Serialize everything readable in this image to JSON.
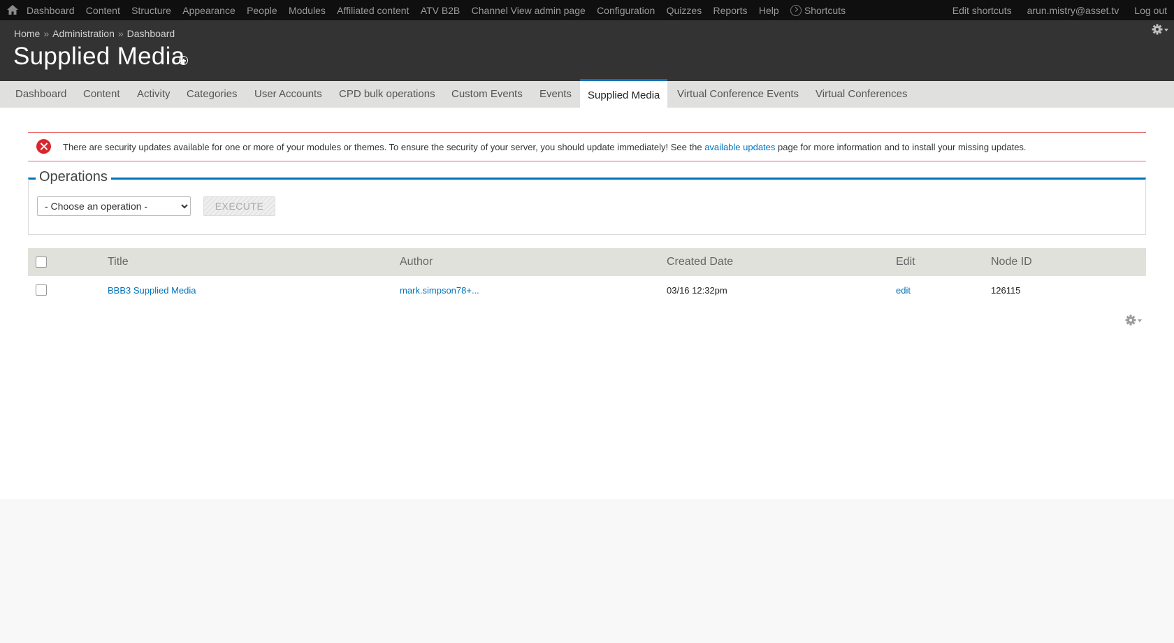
{
  "toolbar": {
    "menu": [
      "Dashboard",
      "Content",
      "Structure",
      "Appearance",
      "People",
      "Modules",
      "Affiliated content",
      "ATV B2B",
      "Channel View admin page",
      "Configuration",
      "Quizzes",
      "Reports",
      "Help"
    ],
    "shortcuts_label": "Shortcuts",
    "edit_shortcuts": "Edit shortcuts",
    "user": "arun.mistry@asset.tv",
    "logout": "Log out"
  },
  "header": {
    "breadcrumb": [
      "Home",
      "Administration",
      "Dashboard"
    ],
    "breadcrumb_separator": "»",
    "title": "Supplied Media"
  },
  "tabs": [
    {
      "label": "Dashboard",
      "active": false
    },
    {
      "label": "Content",
      "active": false
    },
    {
      "label": "Activity",
      "active": false
    },
    {
      "label": "Categories",
      "active": false
    },
    {
      "label": "User Accounts",
      "active": false
    },
    {
      "label": "CPD bulk operations",
      "active": false
    },
    {
      "label": "Custom Events",
      "active": false
    },
    {
      "label": "Events",
      "active": false
    },
    {
      "label": "Supplied Media",
      "active": true
    },
    {
      "label": "Virtual Conference Events",
      "active": false
    },
    {
      "label": "Virtual Conferences",
      "active": false
    }
  ],
  "alert": {
    "text_before": "There are security updates available for one or more of your modules or themes. To ensure the security of your server, you should update immediately! See the ",
    "link": "available updates",
    "text_after": " page for more information and to install your missing updates."
  },
  "operations": {
    "legend": "Operations",
    "select_value": "- Choose an operation -",
    "execute_label": "EXECUTE"
  },
  "table": {
    "columns": [
      "Title",
      "Author",
      "Created Date",
      "Edit",
      "Node ID"
    ],
    "rows": [
      {
        "title": "BBB3 Supplied Media",
        "author": "mark.simpson78+...",
        "created": "03/16 12:32pm",
        "edit": "edit",
        "node_id": "126115"
      }
    ]
  },
  "colors": {
    "accent": "#0074bd",
    "error": "#d9262e",
    "toolbar_bg": "#0f0f0f",
    "header_bg": "#333333"
  }
}
